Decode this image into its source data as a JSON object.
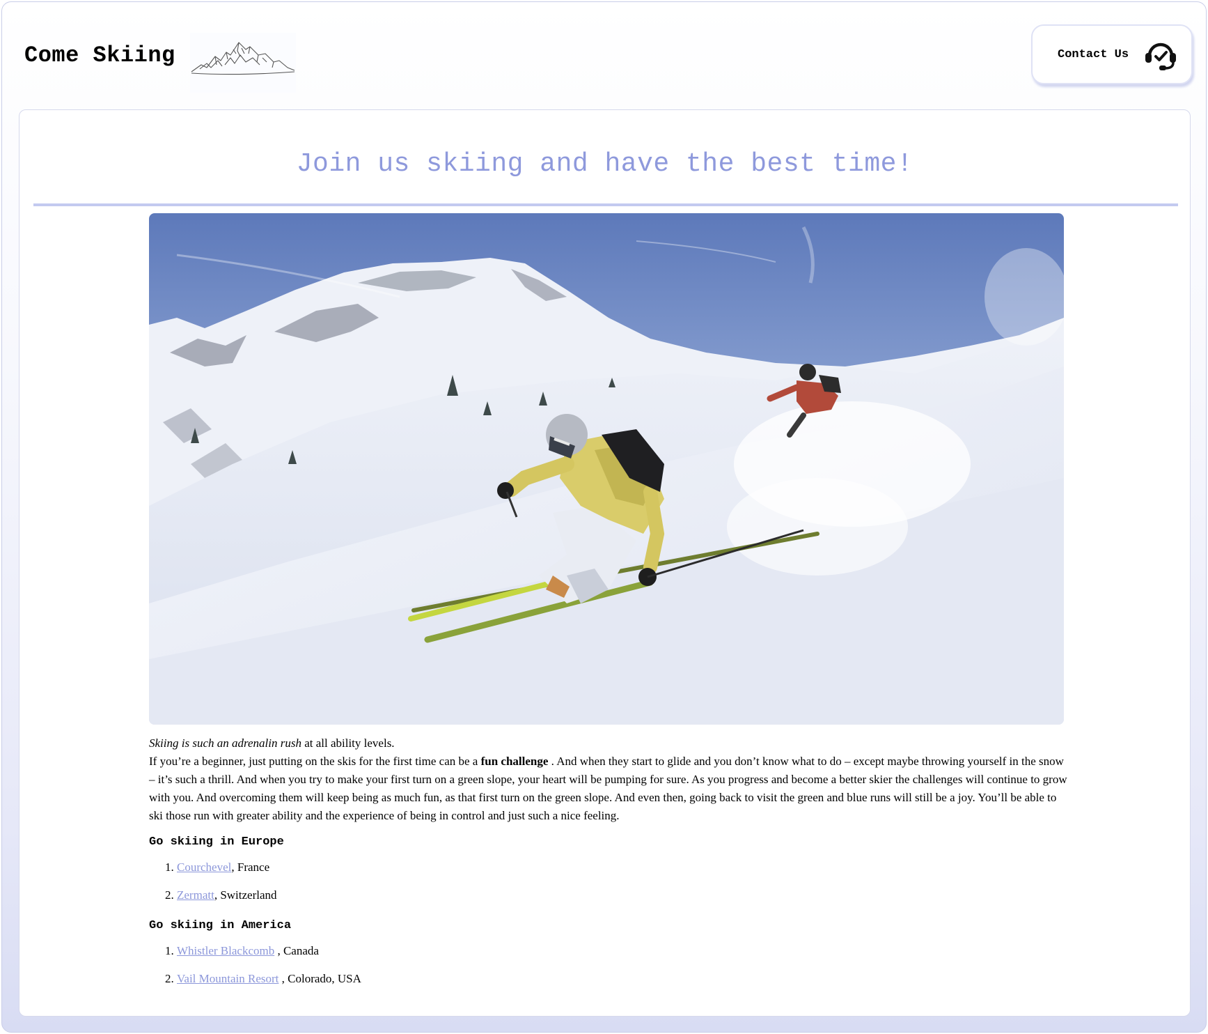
{
  "header": {
    "site_title": "Come Skiing",
    "contact_label": "Contact Us"
  },
  "main": {
    "heading": "Join us skiing and have the best time!",
    "intro_italic": "Skiing is such an adrenalin rush",
    "intro_rest": " at all ability levels.",
    "para_start": "If you’re a beginner, just putting on the skis for the first time can be a ",
    "para_bold": "fun challenge",
    "para_end": " . And when they start to glide and you don’t know what to do – except maybe throwing yourself in the snow – it’s such a thrill. And when you try to make your first turn on a green slope, your heart will be pumping for sure. As you progress and become a better skier the challenges will continue to grow with you. And overcoming them will keep being as much fun, as that first turn on the green slope. And even then, going back to visit the green and blue runs will still be a joy. You’ll be able to ski those run with greater ability and the experience of being in control and just such a nice feeling.",
    "europe": {
      "heading": "Go skiing in Europe",
      "items": [
        {
          "number": "1.",
          "link": "Courchevel",
          "rest": ", France"
        },
        {
          "number": "2.",
          "link": "Zermatt",
          "rest": ", Switzerland"
        }
      ]
    },
    "america": {
      "heading": "Go skiing in America",
      "items": [
        {
          "number": "1.",
          "link": "Whistler Blackcomb",
          "rest": " , Canada"
        },
        {
          "number": "2.",
          "link": "Vail Mountain Resort",
          "rest": " , Colorado, USA"
        }
      ]
    }
  },
  "colors": {
    "accent": "#8e99dc",
    "link": "#8c97da",
    "divider": "#c3caf0"
  },
  "icons": {
    "logo": "mountain-logo-icon",
    "contact": "headset-check-icon"
  }
}
